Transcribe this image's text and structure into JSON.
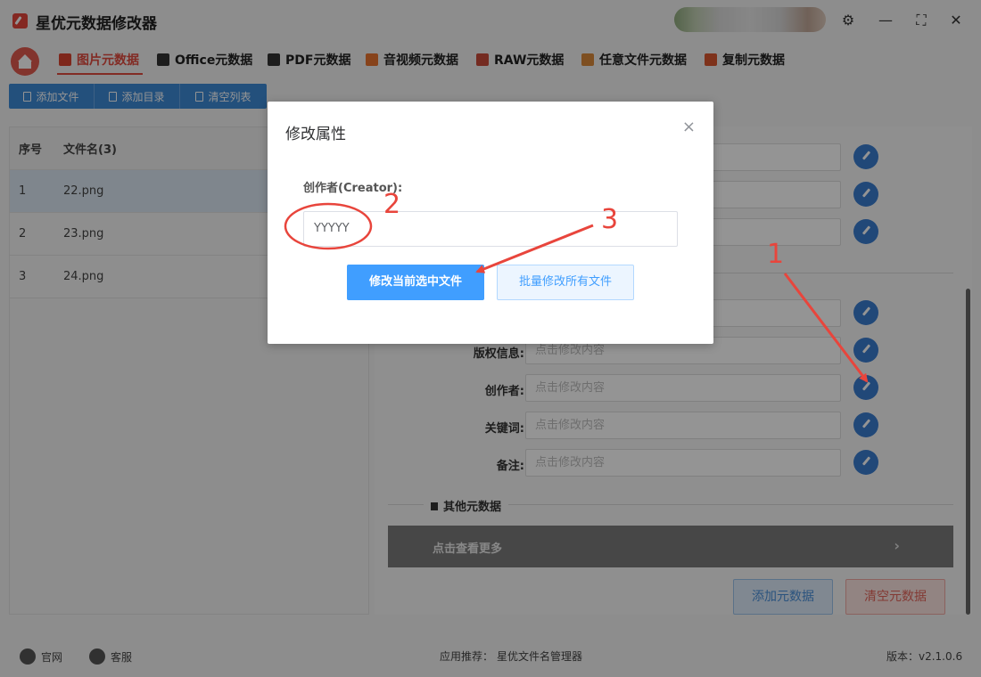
{
  "app": {
    "title": "星优元数据修改器"
  },
  "window": {
    "settings_icon": "sliders-icon",
    "minimize": "minimize-icon",
    "maximize": "maximize-icon",
    "close": "close-icon"
  },
  "tabs": [
    {
      "label": "图片元数据",
      "active": true
    },
    {
      "label": "Office元数据"
    },
    {
      "label": "PDF元数据"
    },
    {
      "label": "音视频元数据"
    },
    {
      "label": "RAW元数据"
    },
    {
      "label": "任意文件元数据"
    },
    {
      "label": "复制元数据"
    }
  ],
  "toolbar": {
    "add_file": "添加文件",
    "add_dir": "添加目录",
    "clear_list": "清空列表"
  },
  "file_list": {
    "columns": [
      "序号",
      "文件名(3)"
    ],
    "rows": [
      {
        "no": "1",
        "name": "22.png",
        "selected": true
      },
      {
        "no": "2",
        "name": "23.png"
      },
      {
        "no": "3",
        "name": "24.png"
      }
    ]
  },
  "fields": [
    {
      "label": "版权信息:",
      "placeholder": "点击修改内容"
    },
    {
      "label": "创作者:",
      "placeholder": "点击修改内容"
    },
    {
      "label": "关键词:",
      "placeholder": "点击修改内容"
    },
    {
      "label": "备注:",
      "placeholder": "点击修改内容"
    }
  ],
  "other_section": {
    "title": "其他元数据",
    "more": "点击查看更多"
  },
  "actions": {
    "add_meta": "添加元数据",
    "clear_meta": "清空元数据"
  },
  "dialog": {
    "title": "修改属性",
    "close": "×",
    "field_label": "创作者(Creator):",
    "field_value": "YYYYY",
    "primary_button": "修改当前选中文件",
    "secondary_button": "批量修改所有文件"
  },
  "annotations": [
    "1",
    "2",
    "3"
  ],
  "status": {
    "website": "官网",
    "support": "客服",
    "recommend": "应用推荐：",
    "recommend_app": "星优文件名管理器",
    "version": "版本：v2.1.0.6"
  },
  "colors": {
    "accent": "#e04a3e",
    "primary": "#409eff",
    "annotation": "#e8453c"
  }
}
